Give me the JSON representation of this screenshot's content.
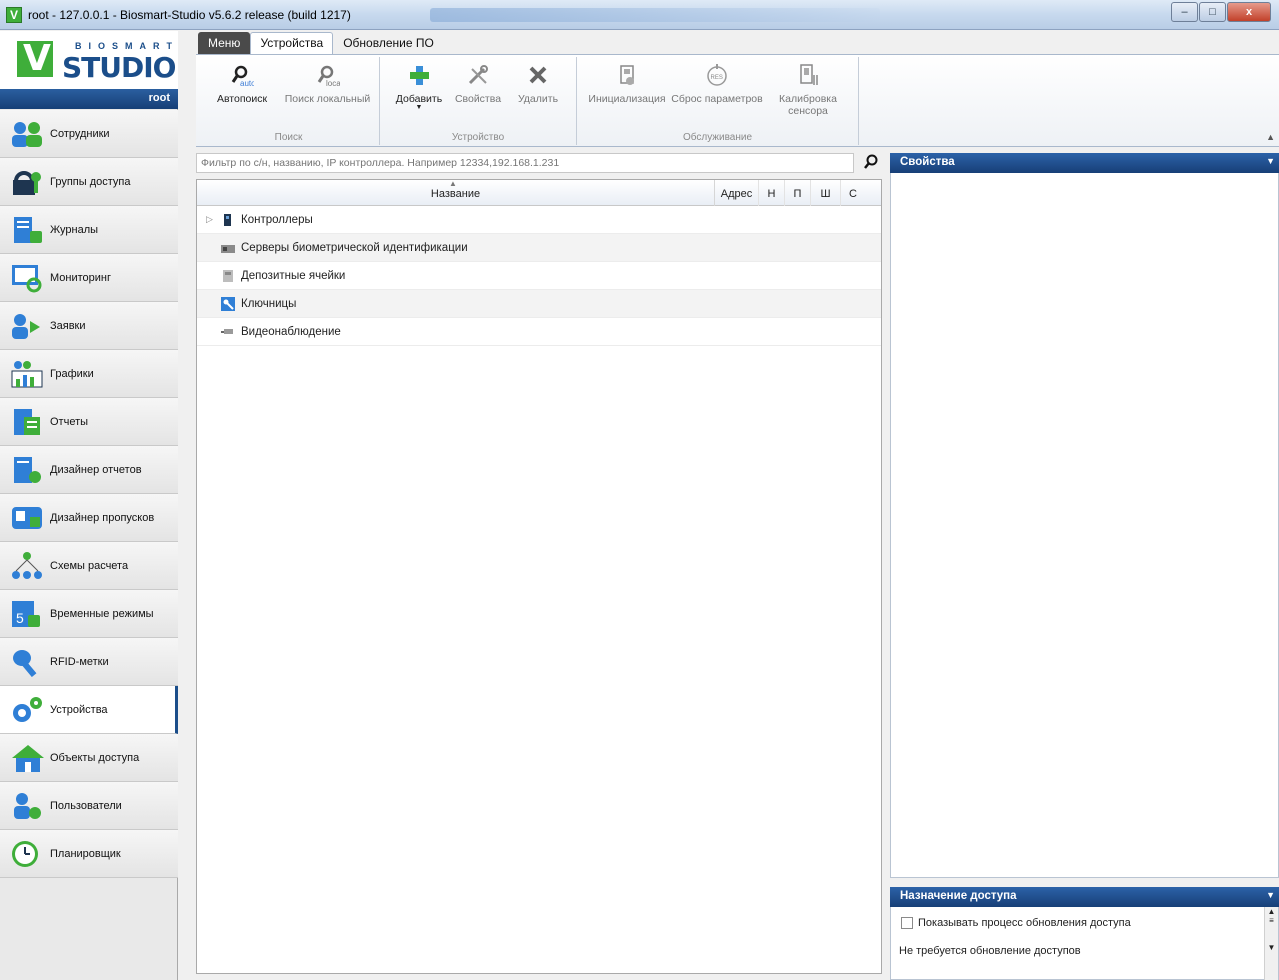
{
  "window": {
    "title": "root - 127.0.0.1 - Biosmart-Studio v5.6.2 release (build 1217)",
    "minimize": "–",
    "maximize": "□",
    "close": "x"
  },
  "logo": {
    "brand_small": "BIOSMART",
    "brand_large": "STUDIO",
    "user": "root"
  },
  "sidebar": {
    "items": [
      {
        "label": "Сотрудники",
        "icon": "employees-icon"
      },
      {
        "label": "Группы доступа",
        "icon": "access-groups-icon"
      },
      {
        "label": "Журналы",
        "icon": "journals-icon"
      },
      {
        "label": "Мониторинг",
        "icon": "monitoring-icon"
      },
      {
        "label": "Заявки",
        "icon": "requests-icon"
      },
      {
        "label": "Графики",
        "icon": "schedules-icon"
      },
      {
        "label": "Отчеты",
        "icon": "reports-icon"
      },
      {
        "label": "Дизайнер отчетов",
        "icon": "report-designer-icon"
      },
      {
        "label": "Дизайнер пропусков",
        "icon": "pass-designer-icon"
      },
      {
        "label": "Схемы расчета",
        "icon": "calc-schemes-icon"
      },
      {
        "label": "Временные режимы",
        "icon": "time-modes-icon"
      },
      {
        "label": "RFID-метки",
        "icon": "rfid-key-icon"
      },
      {
        "label": "Устройства",
        "icon": "devices-gear-icon",
        "active": true
      },
      {
        "label": "Объекты доступа",
        "icon": "access-objects-house-icon"
      },
      {
        "label": "Пользователи",
        "icon": "users-icon"
      },
      {
        "label": "Планировщик",
        "icon": "scheduler-clock-icon"
      }
    ]
  },
  "ribbon": {
    "tabs": [
      "Меню",
      "Устройства",
      "Обновление ПО"
    ],
    "active_tab": "Устройства",
    "groups": [
      {
        "label": "Поиск",
        "buttons": [
          {
            "label": "Автопоиск",
            "sub": "auto",
            "icon": "auto-search-icon"
          },
          {
            "label": "Поиск локальный",
            "sub": "local",
            "icon": "local-search-icon"
          }
        ]
      },
      {
        "label": "Устройство",
        "buttons": [
          {
            "label": "Добавить",
            "icon": "add-plus-icon"
          },
          {
            "label": "Свойства",
            "icon": "properties-tools-icon"
          },
          {
            "label": "Удалить",
            "icon": "delete-x-icon"
          }
        ]
      },
      {
        "label": "Обслуживание",
        "buttons": [
          {
            "label": "Инициализация",
            "icon": "initialize-icon"
          },
          {
            "label": "Сброс параметров",
            "sub": "RES",
            "icon": "reset-params-icon"
          },
          {
            "label": "Калибровка",
            "label2": "сенсора",
            "icon": "calibrate-sensor-icon"
          }
        ]
      }
    ]
  },
  "filter": {
    "placeholder": "Фильтр по с/н, названию, IP контроллера. Например 12334,192.168.1.231"
  },
  "grid": {
    "columns": [
      "Название",
      "Адрес",
      "Н",
      "П",
      "Ш",
      "С"
    ],
    "rows": [
      {
        "label": "Контроллеры",
        "expandable": true,
        "icon": "controller-icon"
      },
      {
        "label": "Серверы биометрической идентификации",
        "icon": "bio-server-icon"
      },
      {
        "label": "Депозитные ячейки",
        "icon": "deposit-cell-icon"
      },
      {
        "label": "Ключницы",
        "icon": "key-box-icon"
      },
      {
        "label": "Видеонаблюдение",
        "icon": "camera-icon"
      }
    ]
  },
  "properties": {
    "title": "Свойства"
  },
  "access": {
    "title": "Назначение доступа",
    "checkbox_label": "Показывать процесс обновления доступа",
    "status": "Не требуется обновление доступов"
  },
  "colors": {
    "accent": "#1b4e8a",
    "brand_green": "#3fae3a",
    "panel_header": "#2c62a8"
  }
}
